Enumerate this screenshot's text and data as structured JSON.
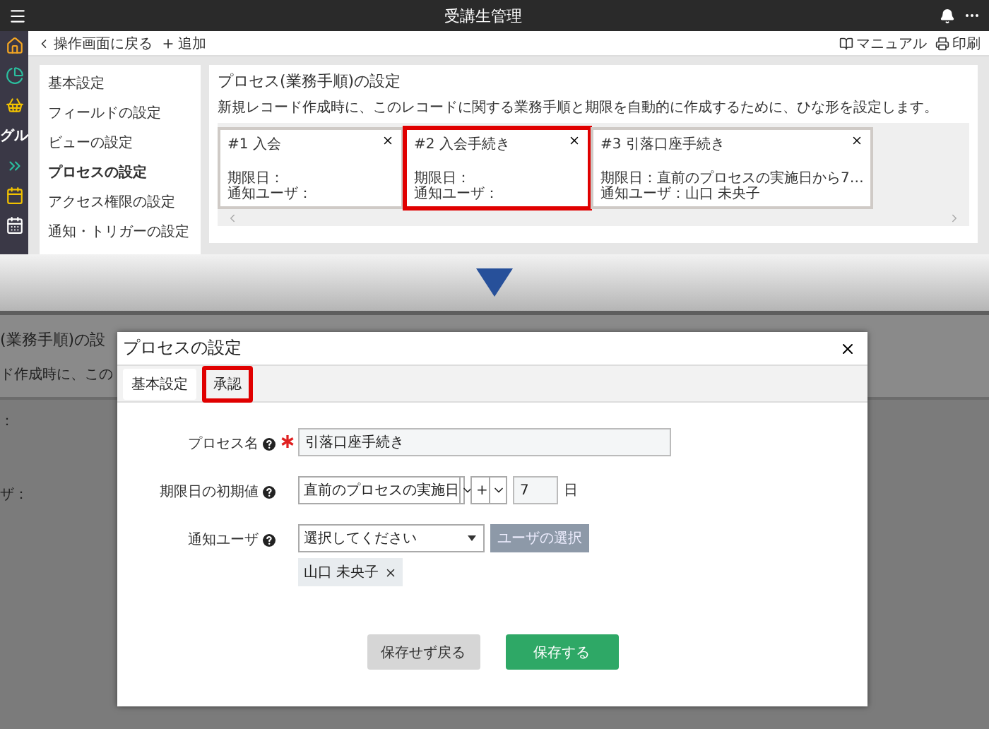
{
  "app_bar": {
    "title": "受講生管理"
  },
  "rail": {
    "label": "グル"
  },
  "toolbar": {
    "back": "操作画面に戻る",
    "add": "追加",
    "manual": "マニュアル",
    "print": "印刷"
  },
  "sidebar": {
    "items": [
      {
        "label": "基本設定",
        "selected": false
      },
      {
        "label": "フィールドの設定",
        "selected": false
      },
      {
        "label": "ビューの設定",
        "selected": false
      },
      {
        "label": "プロセスの設定",
        "selected": true
      },
      {
        "label": "アクセス権限の設定",
        "selected": false
      },
      {
        "label": "通知・トリガーの設定",
        "selected": false
      }
    ]
  },
  "panel": {
    "title": "プロセス(業務手順)の設定",
    "description": "新規レコード作成時に、このレコードに関する業務手順と期限を自動的に作成するために、ひな形を設定します。",
    "cards": [
      {
        "title": "#1 入会",
        "deadline": "期限日：",
        "notify": "通知ユーザ：",
        "highlighted": false
      },
      {
        "title": "#2 入会手続き",
        "deadline": "期限日：",
        "notify": "通知ユーザ：",
        "highlighted": true
      },
      {
        "title": "#3 引落口座手続き",
        "deadline": "期限日：直前のプロセスの実施日から7…",
        "notify": "通知ユーザ：山口 未央子",
        "highlighted": false
      }
    ]
  },
  "background": {
    "title_fragment": "(業務手順)の設",
    "description_fragment": "ド作成時に、この",
    "label_fragments": [
      "：",
      "ザ："
    ]
  },
  "dialog": {
    "title": "プロセスの設定",
    "tabs": [
      {
        "label": "基本設定",
        "selected": true,
        "highlighted": false
      },
      {
        "label": "承認",
        "selected": false,
        "highlighted": true
      }
    ],
    "fields": [
      {
        "kind": "text",
        "label": "プロセス名",
        "required": true,
        "value": "引落口座手続き"
      },
      {
        "kind": "deadline",
        "label": "期限日の初期値",
        "required": false,
        "base": "直前のプロセスの実施日",
        "sign": "+",
        "days": "7",
        "unit": "日"
      },
      {
        "kind": "users",
        "label": "通知ユーザ",
        "required": false,
        "selected_text": "選択してください",
        "button": "ユーザの選択",
        "chips": [
          "山口 未央子"
        ]
      }
    ],
    "buttons": [
      {
        "kind": "secondary",
        "label": "保存せず戻る"
      },
      {
        "kind": "primary",
        "label": "保存する"
      }
    ]
  }
}
